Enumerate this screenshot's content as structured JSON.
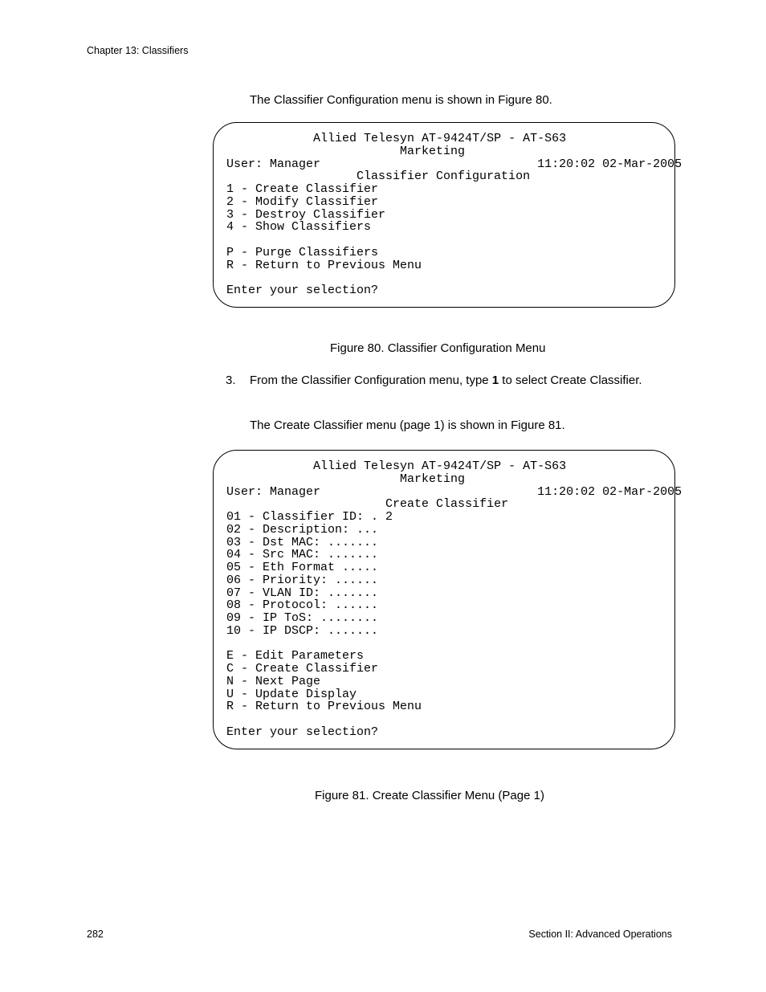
{
  "header": "Chapter 13: Classifiers",
  "intro": "The Classifier Configuration menu is shown in Figure 80.",
  "terminal1": {
    "title_line1": "Allied Telesyn AT-9424T/SP - AT-S63",
    "title_line2": "Marketing",
    "user": "User: Manager",
    "timestamp": "11:20:02 02-Mar-2005",
    "menu_title": "Classifier Configuration",
    "opt1": "1 - Create Classifier",
    "opt2": "2 - Modify Classifier",
    "opt3": "3 - Destroy Classifier",
    "opt4": "4 - Show Classifiers",
    "optP": "P - Purge Classifiers",
    "optR": "R - Return to Previous Menu",
    "prompt": "Enter your selection?"
  },
  "fig80": "Figure 80. Classifier Configuration Menu",
  "step3": {
    "num": "3.",
    "pre": "From the Classifier Configuration menu, type ",
    "bold": "1",
    "post": " to select Create Classifier."
  },
  "para2": "The Create Classifier menu (page 1) is shown in Figure 81.",
  "terminal2": {
    "title_line1": "Allied Telesyn AT-9424T/SP - AT-S63",
    "title_line2": "Marketing",
    "user": "User: Manager",
    "timestamp": "11:20:02 02-Mar-2005",
    "menu_title": "Create Classifier",
    "opt01": "01 - Classifier ID: . 2",
    "opt02": "02 - Description: ...",
    "opt03": "03 - Dst MAC: .......",
    "opt04": "04 - Src MAC: .......",
    "opt05": "05 - Eth Format .....",
    "opt06": "06 - Priority: ......",
    "opt07": "07 - VLAN ID: .......",
    "opt08": "08 - Protocol: ......",
    "opt09": "09 - IP ToS: ........",
    "opt10": "10 - IP DSCP: .......",
    "optE": "E - Edit Parameters",
    "optC": "C - Create Classifier",
    "optN": "N - Next Page",
    "optU": "U - Update Display",
    "optR": "R - Return to Previous Menu",
    "prompt": "Enter your selection?"
  },
  "fig81": "Figure 81. Create Classifier Menu (Page 1)",
  "page_number": "282",
  "section_label": "Section II: Advanced Operations"
}
